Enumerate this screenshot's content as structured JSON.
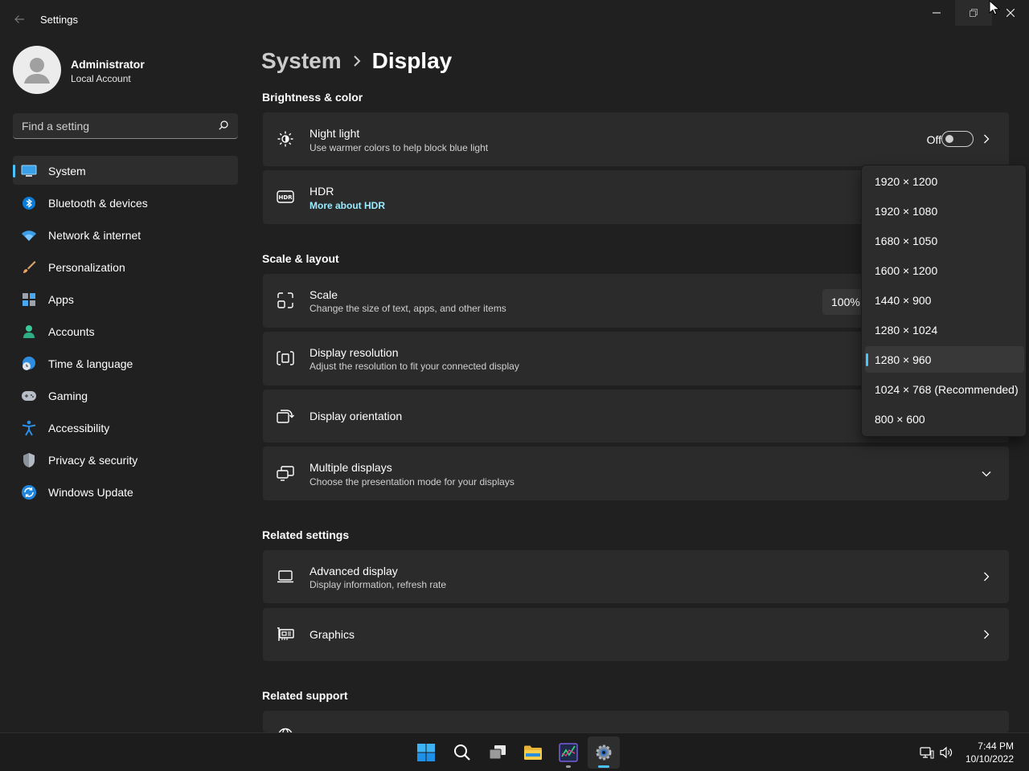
{
  "window": {
    "title": "Settings",
    "back_icon": "back-arrow-icon",
    "minimize_icon": "minimize-icon",
    "maximize_icon": "restore-icon",
    "close_icon": "close-icon"
  },
  "profile": {
    "name": "Administrator",
    "account_type": "Local Account",
    "avatar_icon": "person-icon"
  },
  "search": {
    "placeholder": "Find a setting",
    "icon": "search-icon"
  },
  "sidebar": {
    "items": [
      {
        "label": "System",
        "icon": "monitor-icon",
        "active": true
      },
      {
        "label": "Bluetooth & devices",
        "icon": "bluetooth-icon"
      },
      {
        "label": "Network & internet",
        "icon": "wifi-icon"
      },
      {
        "label": "Personalization",
        "icon": "brush-icon"
      },
      {
        "label": "Apps",
        "icon": "apps-icon"
      },
      {
        "label": "Accounts",
        "icon": "account-icon"
      },
      {
        "label": "Time & language",
        "icon": "clock-globe-icon"
      },
      {
        "label": "Gaming",
        "icon": "controller-icon"
      },
      {
        "label": "Accessibility",
        "icon": "accessibility-icon"
      },
      {
        "label": "Privacy & security",
        "icon": "shield-icon"
      },
      {
        "label": "Windows Update",
        "icon": "update-icon"
      }
    ]
  },
  "breadcrumb": {
    "parent": "System",
    "current": "Display"
  },
  "sections": {
    "brightness": "Brightness & color",
    "scale": "Scale & layout",
    "related_settings": "Related settings",
    "related_support": "Related support"
  },
  "cards": {
    "night_light": {
      "title": "Night light",
      "subtitle": "Use warmer colors to help block blue light",
      "toggle_state": "Off",
      "icon": "brightness-icon"
    },
    "hdr": {
      "title": "HDR",
      "link": "More about HDR",
      "icon": "hdr-icon"
    },
    "scale": {
      "title": "Scale",
      "subtitle": "Change the size of text, apps, and other items",
      "value": "100%",
      "icon": "scale-icon"
    },
    "resolution": {
      "title": "Display resolution",
      "subtitle": "Adjust the resolution to fit your connected display",
      "icon": "resolution-icon"
    },
    "orientation": {
      "title": "Display orientation",
      "icon": "orientation-icon"
    },
    "multiple_displays": {
      "title": "Multiple displays",
      "subtitle": "Choose the presentation mode for your displays",
      "icon": "multiple-displays-icon"
    },
    "advanced_display": {
      "title": "Advanced display",
      "subtitle": "Display information, refresh rate",
      "icon": "laptop-icon"
    },
    "graphics": {
      "title": "Graphics",
      "icon": "graphics-card-icon"
    }
  },
  "resolution_dropdown": {
    "options": [
      "1920 × 1200",
      "1920 × 1080",
      "1680 × 1050",
      "1600 × 1200",
      "1440 × 900",
      "1280 × 1024",
      "1280 × 960",
      "1024 × 768 (Recommended)",
      "800 × 600"
    ],
    "selected": "1280 × 960"
  },
  "taskbar": {
    "apps": [
      "start-icon",
      "search-icon",
      "task-view-icon",
      "file-explorer-icon",
      "chart-app-icon",
      "settings-icon"
    ],
    "tray_icons": [
      "network-icon",
      "volume-icon"
    ],
    "time": "7:44 PM",
    "date": "10/10/2022"
  },
  "colors": {
    "accent": "#4cc2ff",
    "background": "#202020",
    "card": "#2b2b2b",
    "link": "#99ebff"
  }
}
